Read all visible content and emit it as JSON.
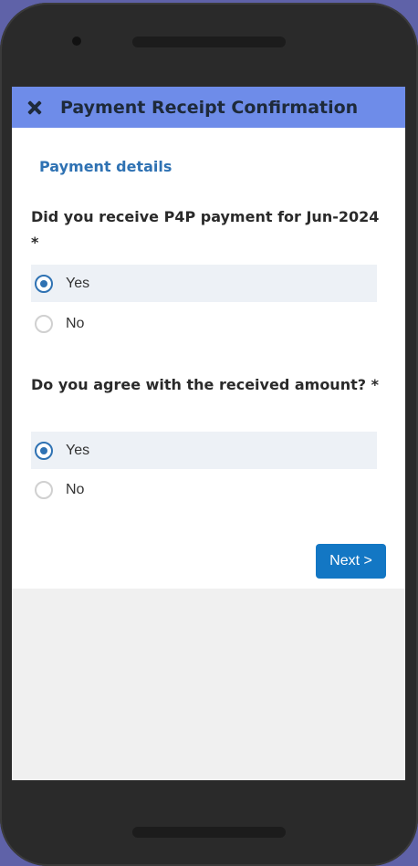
{
  "header": {
    "title": "Payment Receipt Confirmation"
  },
  "section": {
    "title": "Payment details"
  },
  "questions": [
    {
      "text": "Did you receive P4P payment for Jun-2024 *",
      "options": [
        {
          "label": "Yes",
          "checked": true
        },
        {
          "label": "No",
          "checked": false
        }
      ]
    },
    {
      "text": "Do you agree with the received amount? *",
      "options": [
        {
          "label": "Yes",
          "checked": true
        },
        {
          "label": "No",
          "checked": false
        }
      ]
    }
  ],
  "next_button": {
    "label": "Next >"
  },
  "colors": {
    "header_bg": "#6e8ce9",
    "accent": "#2f72b3",
    "button": "#1377c4",
    "selected_row": "#edf1f6"
  }
}
